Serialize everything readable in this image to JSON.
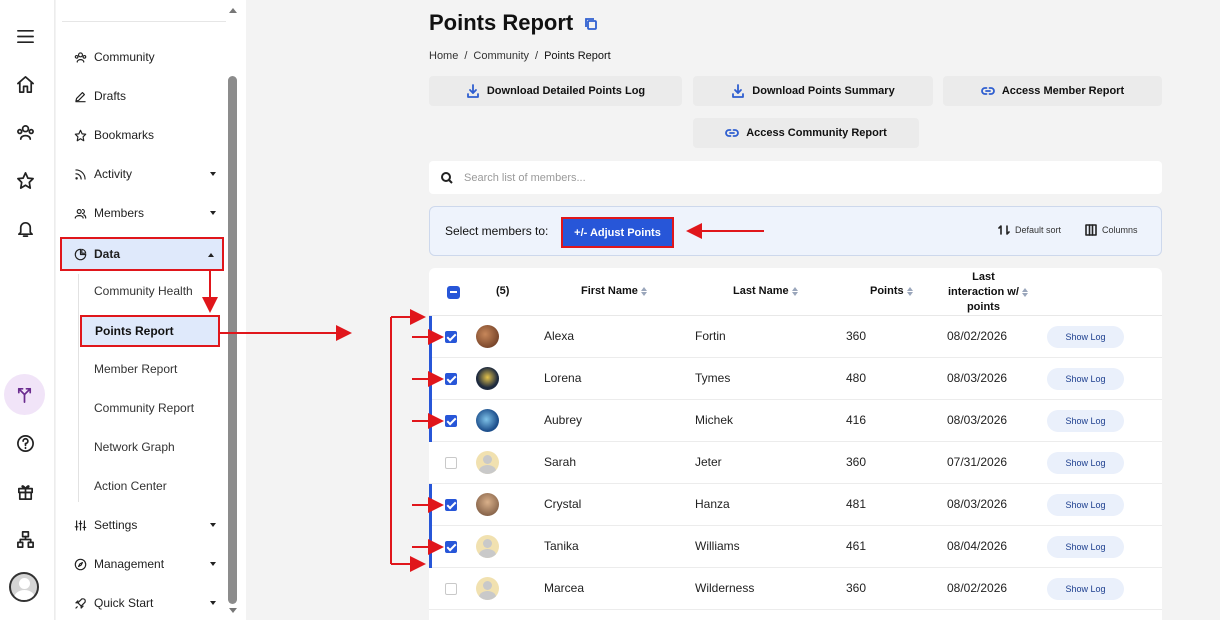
{
  "sidebar": {
    "items": [
      {
        "label": "Community",
        "icon": "community-icon"
      },
      {
        "label": "Drafts",
        "icon": "pencil-icon"
      },
      {
        "label": "Bookmarks",
        "icon": "star-icon"
      },
      {
        "label": "Activity",
        "icon": "rss-icon"
      },
      {
        "label": "Members",
        "icon": "members-icon"
      },
      {
        "label": "Data",
        "icon": "pie-chart-icon"
      },
      {
        "label": "Settings",
        "icon": "sliders-icon"
      },
      {
        "label": "Management",
        "icon": "compass-icon"
      },
      {
        "label": "Quick Start",
        "icon": "rocket-icon"
      }
    ],
    "data_subitems": [
      "Community Health",
      "Points Report",
      "Member Report",
      "Community Report",
      "Network Graph",
      "Action Center"
    ]
  },
  "header": {
    "title": "Points Report",
    "breadcrumb": [
      "Home",
      "Community",
      "Points Report"
    ],
    "breadcrumb_sep": "/"
  },
  "actions": {
    "download_log": "Download Detailed Points Log",
    "download_summary": "Download Points Summary",
    "member_report": "Access Member Report",
    "community_report": "Access Community Report"
  },
  "search": {
    "placeholder": "Search list of members..."
  },
  "selectbar": {
    "label": "Select members to:",
    "adjust": "+/- Adjust Points",
    "sort": "Default sort",
    "columns": "Columns"
  },
  "table": {
    "count": "(5)",
    "headers": {
      "first": "First Name",
      "last": "Last Name",
      "points": "Points",
      "last_interaction_lines": [
        "Last",
        "interaction w/",
        "points"
      ]
    },
    "show_log": "Show Log",
    "rows": [
      {
        "first": "Alexa",
        "last": "Fortin",
        "points": "360",
        "date": "08/02/2026",
        "checked": true,
        "avatar": "photo-brown"
      },
      {
        "first": "Lorena",
        "last": "Tymes",
        "points": "480",
        "date": "08/03/2026",
        "checked": true,
        "avatar": "photo-dark"
      },
      {
        "first": "Aubrey",
        "last": "Michek",
        "points": "416",
        "date": "08/03/2026",
        "checked": true,
        "avatar": "photo-blue"
      },
      {
        "first": "Sarah",
        "last": "Jeter",
        "points": "360",
        "date": "07/31/2026",
        "checked": false,
        "avatar": "default"
      },
      {
        "first": "Crystal",
        "last": "Hanza",
        "points": "481",
        "date": "08/03/2026",
        "checked": true,
        "avatar": "photo-tan"
      },
      {
        "first": "Tanika",
        "last": "Williams",
        "points": "461",
        "date": "08/04/2026",
        "checked": true,
        "avatar": "default"
      },
      {
        "first": "Marcea",
        "last": "Wilderness",
        "points": "360",
        "date": "08/02/2026",
        "checked": false,
        "avatar": "default"
      }
    ]
  },
  "colors": {
    "accent": "#2756d8",
    "annotation": "#e0161b",
    "highlight": "#dfe9fb"
  }
}
